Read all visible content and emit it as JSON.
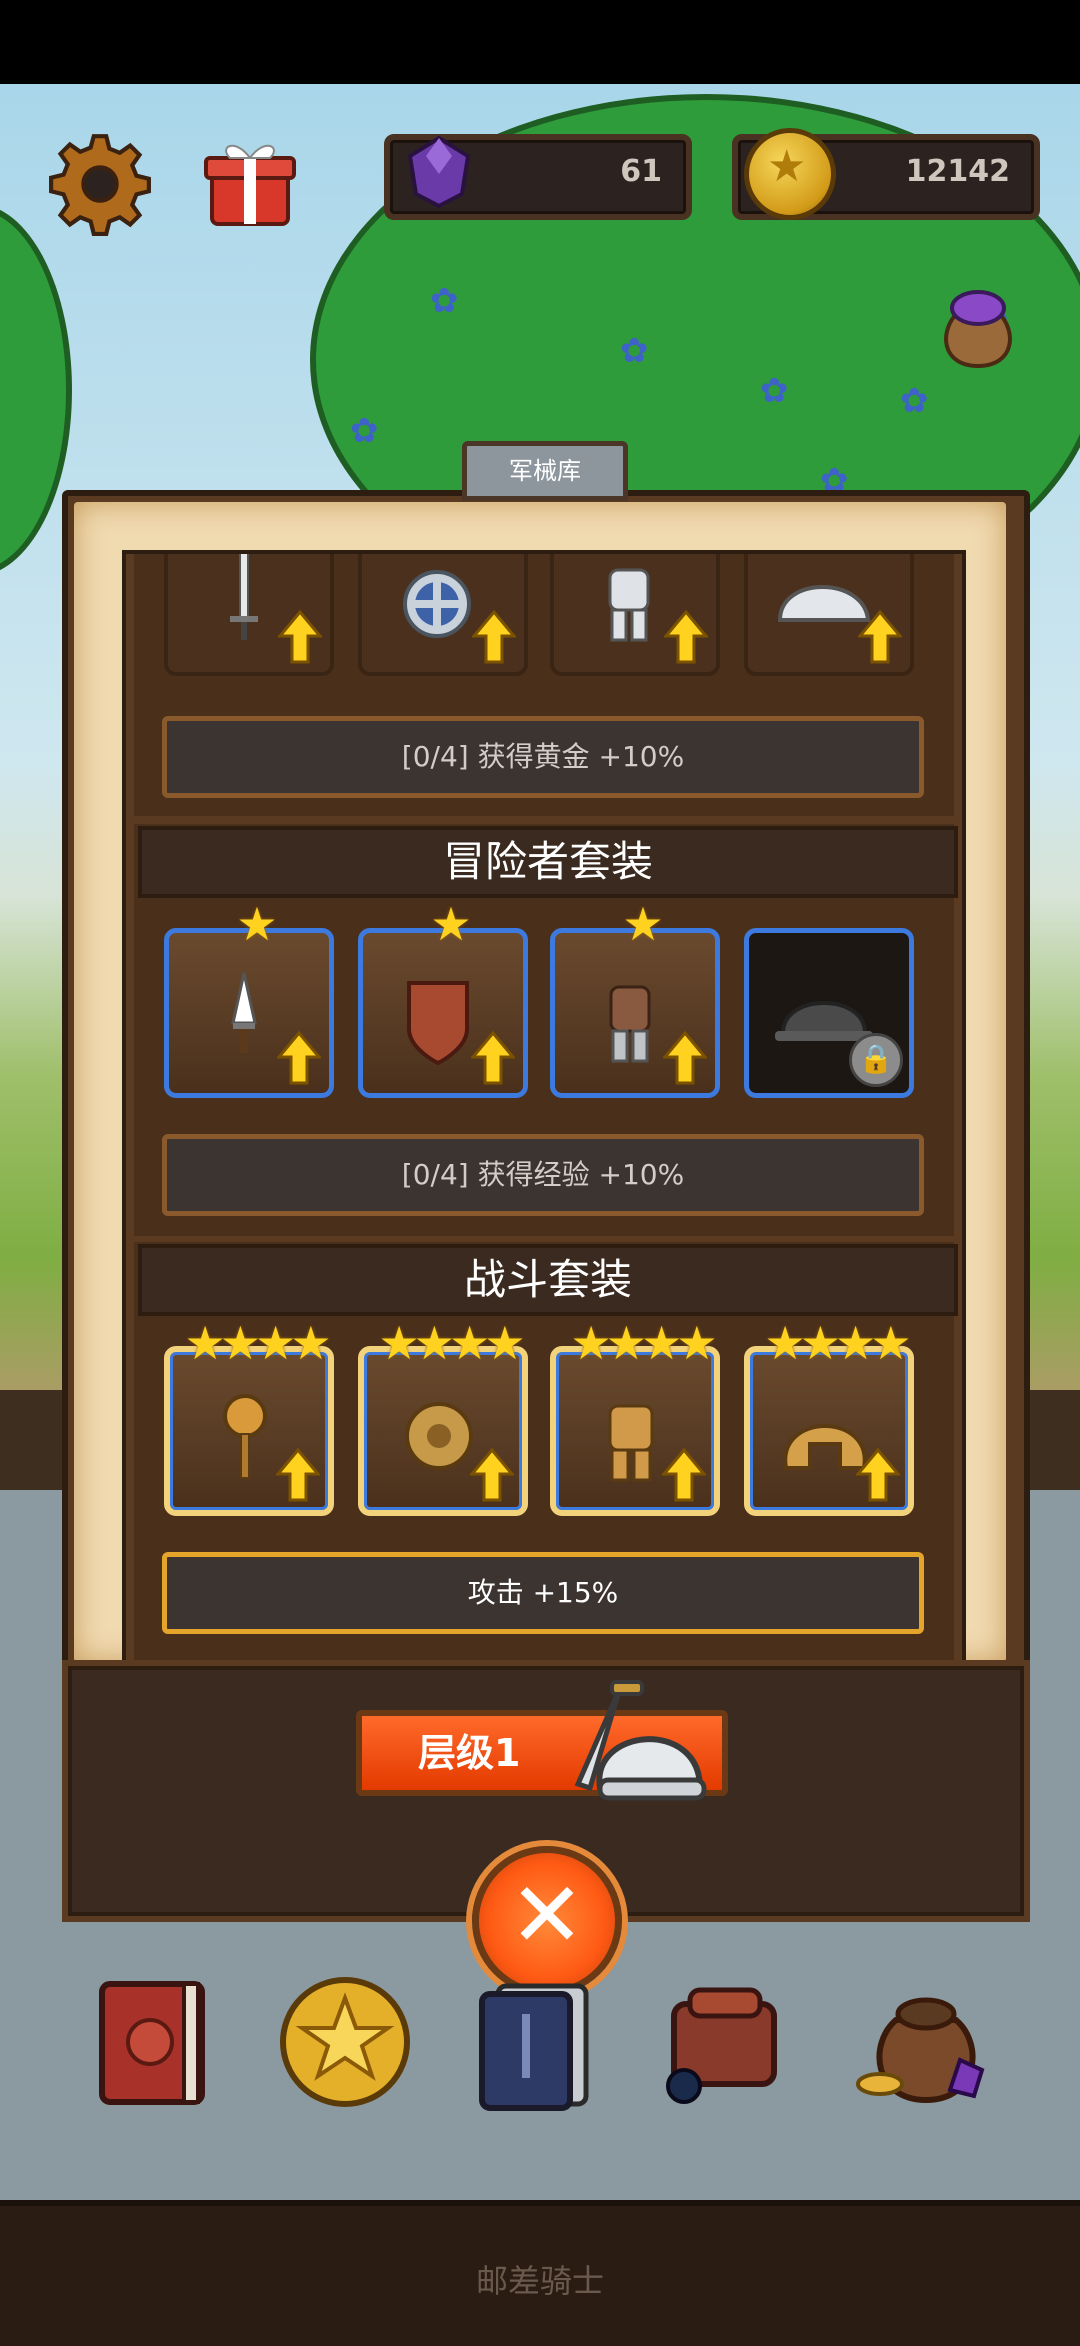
{
  "hud": {
    "gems": "61",
    "gold": "12142",
    "icons": [
      "gear-icon",
      "gift-icon",
      "gem-icon",
      "coin-icon",
      "loot-bag-icon"
    ]
  },
  "panel": {
    "tab_label": "军械库",
    "sections": [
      {
        "title": "",
        "items": [
          "sword-icon",
          "round-shield-icon",
          "plate-armor-icon",
          "helmet-icon"
        ],
        "stars": [
          0,
          0,
          0,
          0
        ],
        "bonus": "[0/4] 获得黄金 +10%"
      },
      {
        "title": "冒险者套装",
        "items": [
          "dagger-icon",
          "wooden-shield-icon",
          "leather-armor-icon",
          "iron-helmet-icon"
        ],
        "stars": [
          1,
          1,
          1,
          0
        ],
        "locked": [
          false,
          false,
          false,
          true
        ],
        "bonus": "[0/4] 获得经验 +10%"
      },
      {
        "title": "战斗套装",
        "items": [
          "mace-icon",
          "bronze-shield-icon",
          "gold-armor-icon",
          "gold-helmet-icon"
        ],
        "stars": [
          4,
          4,
          4,
          4
        ],
        "bonus": "攻击 +15%"
      }
    ],
    "level_label": "层级1",
    "close_icon": "close-icon"
  },
  "bottom_menu": [
    "book-icon",
    "star-coin-icon",
    "card-deck-icon",
    "backpack-icon",
    "treasure-bag-icon"
  ],
  "footer_title": "邮差骑士",
  "colors": {
    "slot_border_blue": "#3d7ae0",
    "star_gold": "#ffd21f",
    "level_orange": "#ff5a14",
    "panel_brown": "#5b3a22"
  }
}
